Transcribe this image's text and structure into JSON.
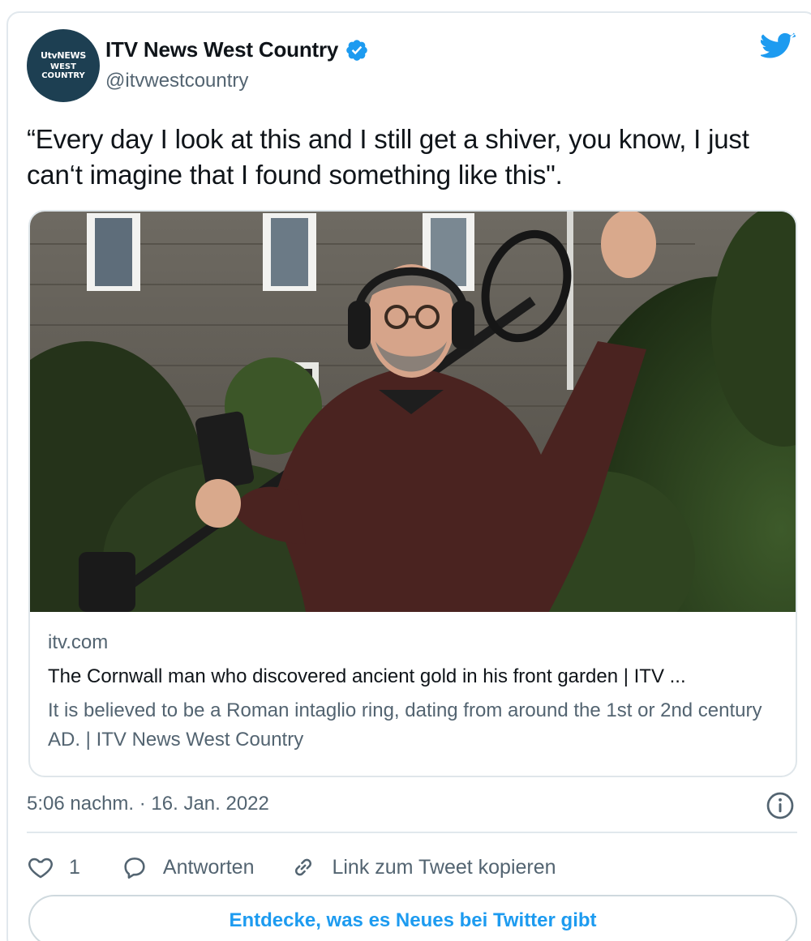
{
  "author": {
    "display_name": "ITV News West Country",
    "handle": "@itvwestcountry",
    "avatar_text": {
      "line1": "UtvNEWS",
      "line2": "WEST",
      "line3": "COUNTRY"
    },
    "verified": true
  },
  "tweet": {
    "text": "“Every day I look at this and I still get a shiver, you know, I just can‘t imagine that I found something like this\".",
    "timestamp": "5:06 nachm. · 16. Jan. 2022"
  },
  "link_card": {
    "domain": "itv.com",
    "title": "The Cornwall man who discovered ancient gold in his front garden | ITV ...",
    "description": "It is believed to be a Roman intaglio ring, dating from around the 1st or 2nd century AD. | ITV News West Country"
  },
  "actions": {
    "like_count": "1",
    "reply_label": "Antworten",
    "copy_link_label": "Link zum Tweet kopieren"
  },
  "discover_button": "Entdecke, was es Neues bei Twitter gibt",
  "icons": {
    "verified": "verified-badge-icon",
    "brand": "twitter-bird-icon",
    "info": "info-icon",
    "like": "heart-icon",
    "reply": "speech-bubble-icon",
    "copy": "link-icon"
  },
  "colors": {
    "accent": "#1d9bf0",
    "text_primary": "#0f1419",
    "text_secondary": "#536471",
    "border": "#e1e8ed"
  }
}
